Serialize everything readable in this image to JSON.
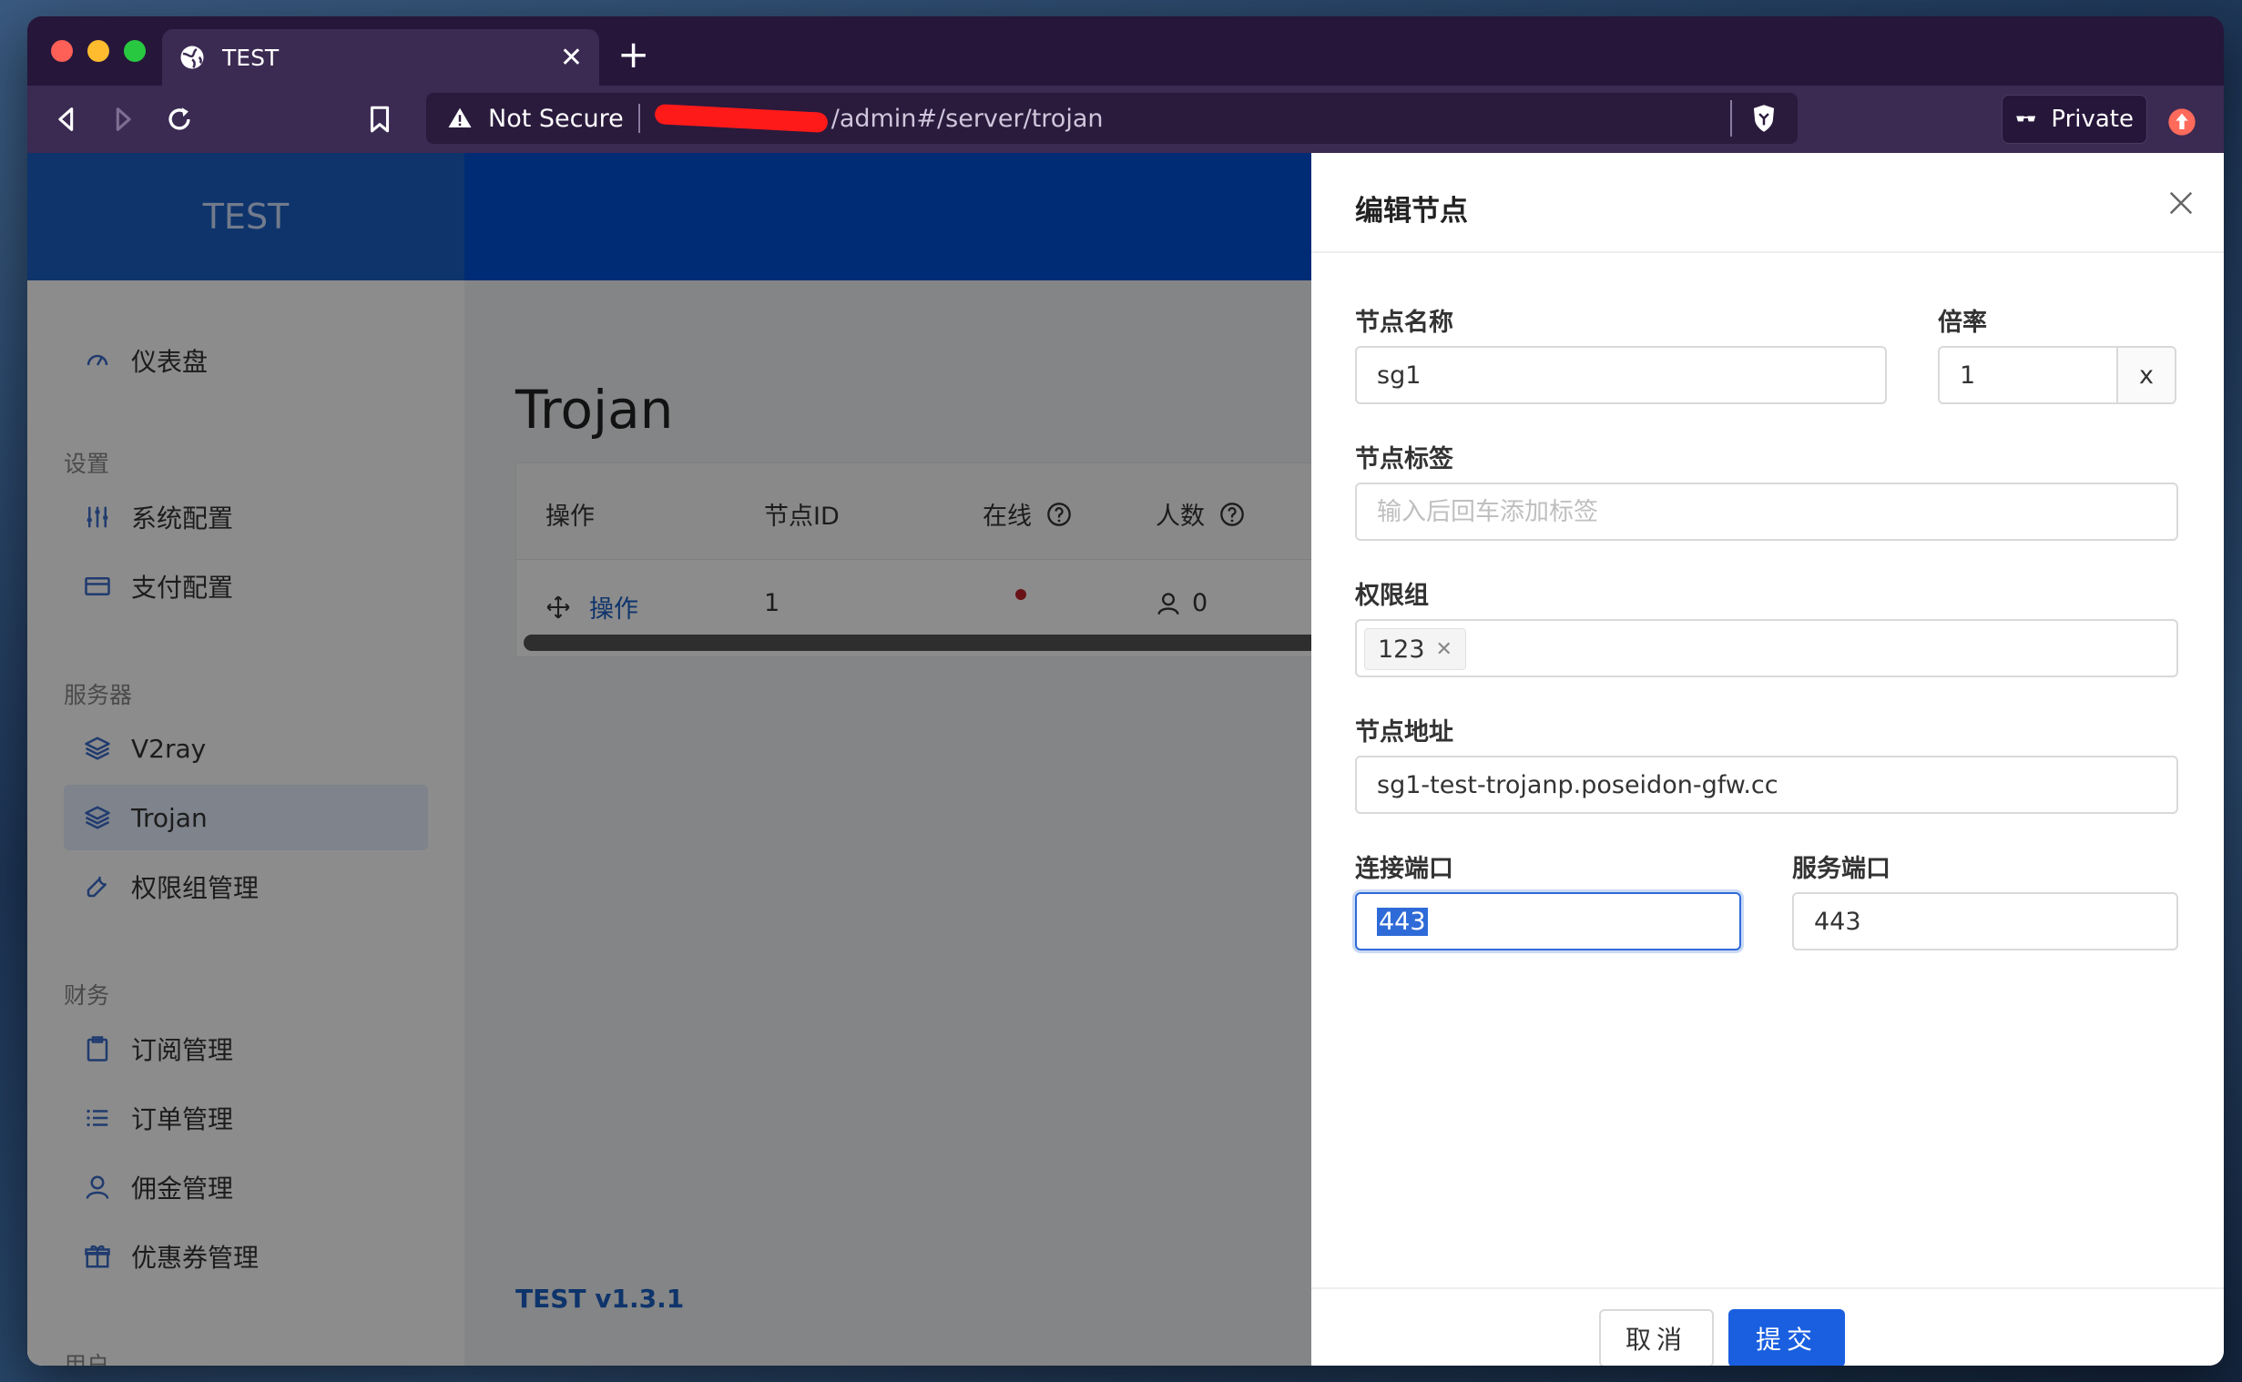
{
  "browser": {
    "tab_title": "TEST",
    "not_secure": "Not Secure",
    "url": "/admin#/server/trojan",
    "private_label": "Private"
  },
  "sidebar": {
    "brand": "TEST",
    "dashboard": "仪表盘",
    "group_settings": "设置",
    "system_config": "系统配置",
    "payment_config": "支付配置",
    "group_servers": "服务器",
    "v2ray": "V2ray",
    "trojan": "Trojan",
    "permission_group": "权限组管理",
    "group_finance": "财务",
    "subscription": "订阅管理",
    "orders": "订单管理",
    "commission": "佣金管理",
    "coupons": "优惠券管理",
    "group_users": "用户"
  },
  "main": {
    "title": "Trojan",
    "columns": {
      "action": "操作",
      "node_id": "节点ID",
      "online": "在线",
      "count": "人数"
    },
    "rows": [
      {
        "action": "操作",
        "node_id": "1",
        "count": "0"
      }
    ],
    "version": "TEST v1.3.1"
  },
  "drawer": {
    "title": "编辑节点",
    "name_label": "节点名称",
    "name_value": "sg1",
    "rate_label": "倍率",
    "rate_value": "1",
    "rate_suffix": "x",
    "tags_label": "节点标签",
    "tags_placeholder": "输入后回车添加标签",
    "group_label": "权限组",
    "group_tag": "123",
    "address_label": "节点地址",
    "address_value": "sg1-test-trojanp.poseidon-gfw.cc",
    "port_label": "连接端口",
    "port_value": "443",
    "server_port_label": "服务端口",
    "server_port_value": "443",
    "cancel": "取消",
    "submit": "提交"
  },
  "colors": {
    "header_blue": "#0050d8",
    "brand_blue": "#1a5fc4",
    "submit_blue": "#1a5fe0",
    "online_dot": "#c0232c"
  }
}
